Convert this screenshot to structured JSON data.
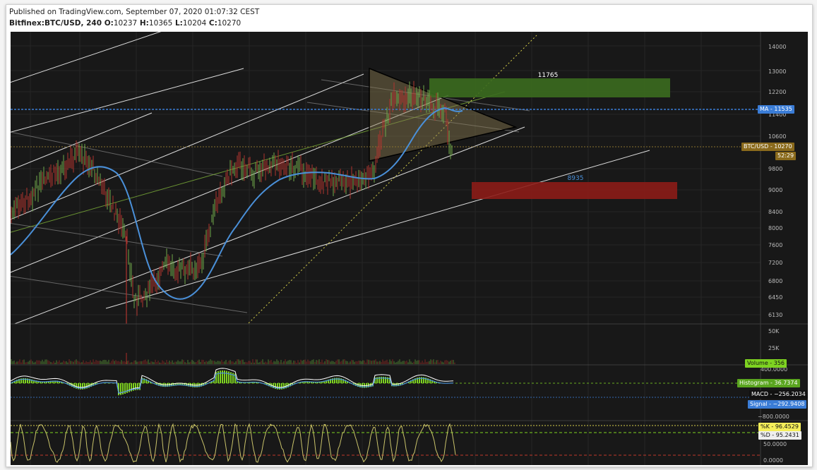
{
  "header": {
    "published": "Published on TradingView.com, September 07, 2020 01:07:32 CEST",
    "symbol": "Bitfinex:BTC/USD, 240",
    "open_key": "O:",
    "open": "10237",
    "high_key": "H:",
    "high": "10365",
    "low_key": "L:",
    "low": "10204",
    "close_key": "C:",
    "close": "10270"
  },
  "price_axis": {
    "ticks": [
      "14000",
      "13000",
      "12200",
      "11400",
      "10600",
      "9800",
      "9000",
      "8400",
      "8000",
      "7600",
      "7200",
      "6800",
      "6450",
      "6130"
    ]
  },
  "zones": {
    "resistance_label": "11765",
    "support_label": "8935"
  },
  "tags": {
    "ma": "MA - 11535",
    "price": "BTC/USD - 10270",
    "countdown": "52:29"
  },
  "volume": {
    "ticks": [
      "50K",
      "25K"
    ],
    "label": "Volume - 356"
  },
  "macd": {
    "top_tick": "400.0000",
    "bottom_tick": "−800.0000",
    "histogram": "Histogram - 36.7374",
    "macd": "MACD - −256.2034",
    "signal": "Signal - −292.9408"
  },
  "stoch": {
    "k": "%K - 96.4529",
    "d": "%D - 95.2431",
    "mid_tick": "50.0000",
    "bottom_tick": "0.0000"
  },
  "colors": {
    "background": "#181818",
    "ma_line": "#4a90d9",
    "resistance_zone": "#3b6b1f",
    "support_zone": "#8c1c17",
    "triangle_fill": "#8a7a4f",
    "macd_hist": "#7ed321",
    "stoch_line": "#c9c36a"
  }
}
